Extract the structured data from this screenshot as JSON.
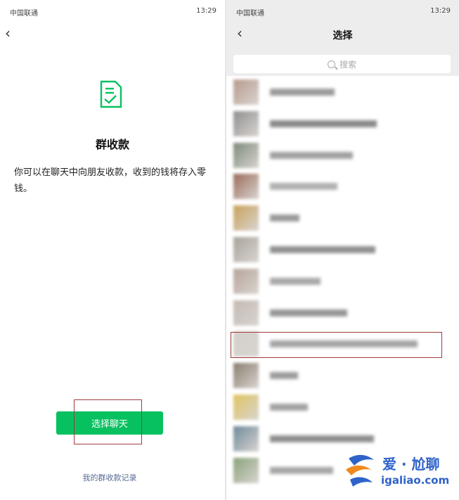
{
  "left": {
    "status": {
      "carrier": "中国联通",
      "time": "13:29"
    },
    "title": "群收款",
    "description": "你可以在聊天中向朋友收款，收到的钱将存入零钱。",
    "select_chat_button": "选择聊天",
    "records_link": "我的群收款记录"
  },
  "right": {
    "status": {
      "carrier": "中国联通",
      "time": "13:29"
    },
    "title": "选择",
    "search": {
      "placeholder": "搜索"
    },
    "contacts": [
      {
        "avatar_color": "#b89a8c",
        "name_color": "#9a9a9a"
      },
      {
        "avatar_color": "#8f8f8f",
        "name_color": "#8a8a8a"
      },
      {
        "avatar_color": "#7d8b7a",
        "name_color": "#a0a0a0"
      },
      {
        "avatar_color": "#9c6b5a",
        "name_color": "#b0b0b0"
      },
      {
        "avatar_color": "#c9a25a",
        "name_color": "#9a9a9a"
      },
      {
        "avatar_color": "#a8a39a",
        "name_color": "#909090"
      },
      {
        "avatar_color": "#b7a49a",
        "name_color": "#a8a8a8"
      },
      {
        "avatar_color": "#c3b9b2",
        "name_color": "#959595"
      },
      {
        "avatar_color": "#d3cfcb",
        "name_color": "#a5a5a5"
      },
      {
        "avatar_color": "#8a7e6e",
        "name_color": "#9c9c9c"
      },
      {
        "avatar_color": "#e0c460",
        "name_color": "#a2a2a2"
      },
      {
        "avatar_color": "#6f8a9a",
        "name_color": "#8e8e8e"
      },
      {
        "avatar_color": "#8aa37a",
        "name_color": "#a6a6a6"
      }
    ]
  },
  "watermark": {
    "line1": "爱 · 尬聊",
    "line2": "igaliao.com"
  },
  "colors": {
    "accent": "#07c160",
    "link": "#576b95",
    "highlight_box": "#a33a3a"
  }
}
